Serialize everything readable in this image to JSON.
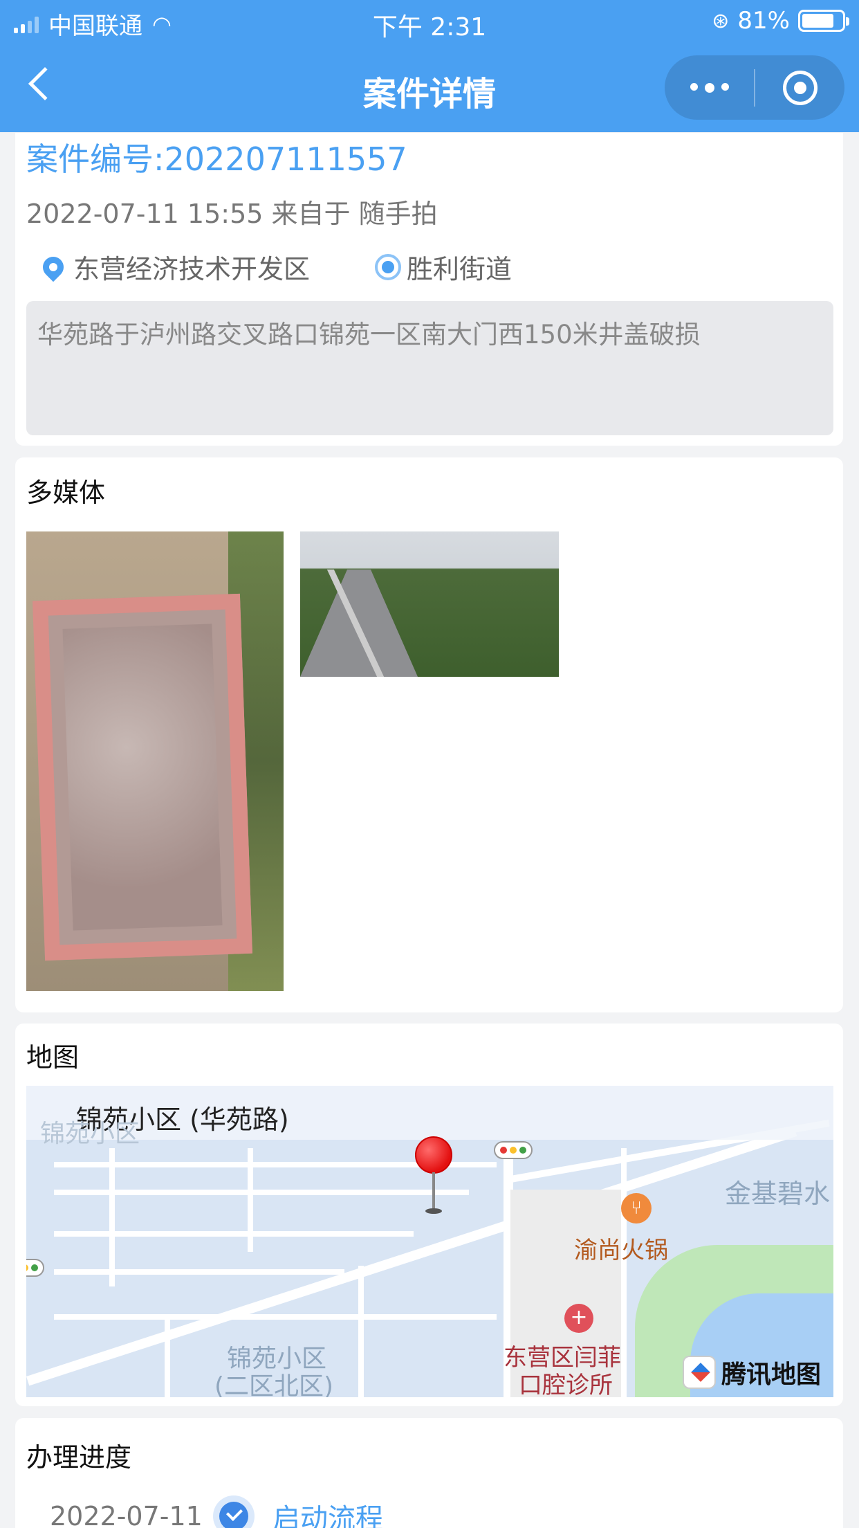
{
  "status_bar": {
    "carrier": "中国联通",
    "time": "下午 2:31",
    "battery": "81%",
    "battery_level": 0.81
  },
  "nav": {
    "title": "案件详情"
  },
  "case": {
    "number": "案件编号:202207111557",
    "meta": "2022-07-11 15:55 来自于 随手拍",
    "district": "东营经济技术开发区",
    "street": "胜利街道",
    "description": "华苑路于泸州路交叉路口锦苑一区南大门西150米井盖破损"
  },
  "media": {
    "title": "多媒体"
  },
  "map": {
    "title": "地图",
    "location_name": "锦苑小区 (华苑路)",
    "labels": {
      "top_left": "锦苑小区",
      "jinji": "金基碧水",
      "restaurant": "渝尚火锅",
      "clinic_line1": "东营区闫菲",
      "clinic_line2": "口腔诊所",
      "area_line1": "锦苑小区",
      "area_line2": "(二区北区)"
    },
    "brand": "腾讯地图"
  },
  "progress": {
    "title": "办理进度",
    "items": [
      {
        "date": "2022-07-11",
        "step": "启动流程"
      }
    ]
  },
  "colors": {
    "primary": "#4aa0f2",
    "background": "#f2f3f5"
  }
}
